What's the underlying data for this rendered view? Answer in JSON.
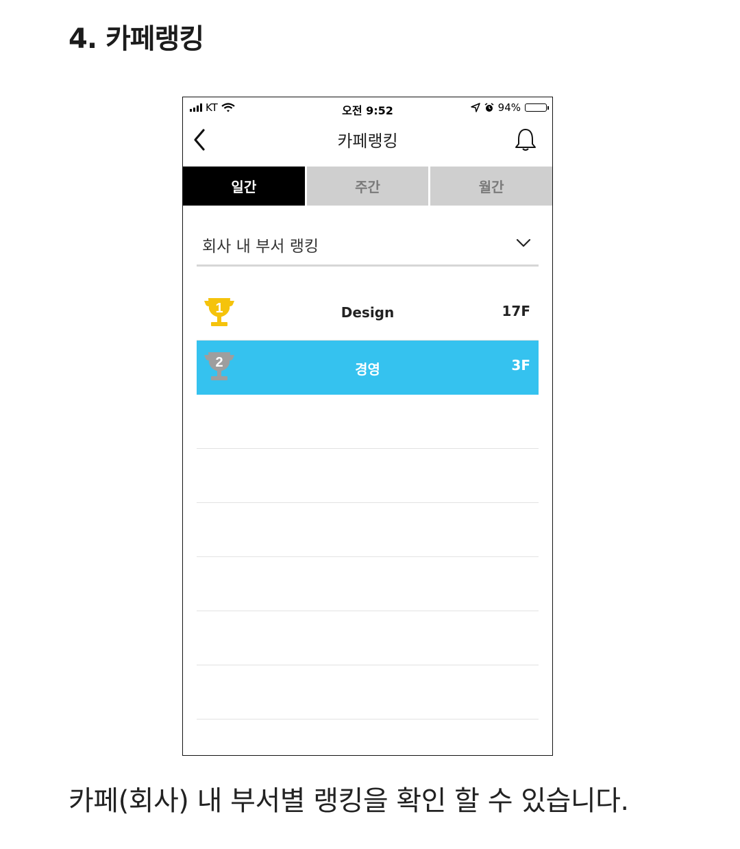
{
  "section_title": "4. 카페랭킹",
  "caption": "카페(회사) 내 부서별 랭킹을 확인 할 수 있습니다.",
  "status_bar": {
    "carrier": "KT",
    "time": "오전 9:52",
    "battery": "94%",
    "battery_level": 0.94,
    "icons": [
      "signal-icon",
      "wifi-icon",
      "location-arrow-icon",
      "alarm-icon",
      "battery-icon"
    ]
  },
  "navbar": {
    "title": "카페랭킹",
    "back_icon": "chevron-left-icon",
    "right_icon": "bell-icon"
  },
  "tabs": [
    {
      "label": "일간",
      "active": true
    },
    {
      "label": "주간",
      "active": false
    },
    {
      "label": "월간",
      "active": false
    }
  ],
  "filter": {
    "selected": "회사 내 부서 랭킹",
    "icon": "chevron-down-icon"
  },
  "ranking": [
    {
      "rank": "1",
      "department": "Design",
      "floor": "17F",
      "trophy_color": "#f5c30c",
      "highlighted": false
    },
    {
      "rank": "2",
      "department": "경영",
      "floor": "3F",
      "trophy_color": "#9e9e9e",
      "highlighted": true
    }
  ],
  "colors": {
    "highlight": "#35c2ef",
    "active_tab": "#000000",
    "inactive_tab": "#cfcfcf",
    "gold": "#f5c30c",
    "silver": "#9e9e9e"
  }
}
